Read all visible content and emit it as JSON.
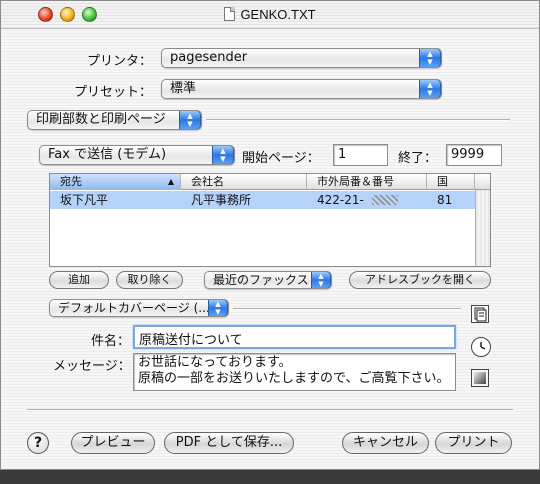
{
  "window": {
    "title": "GENKO.TXT"
  },
  "printer": {
    "label": "プリンタ：",
    "value": "pagesender"
  },
  "preset": {
    "label": "プリセット：",
    "value": "標準"
  },
  "panel_menu": {
    "value": "印刷部数と印刷ページ"
  },
  "fax": {
    "mode_value": "Fax で送信 (モデム)",
    "start_page_label": "開始ページ：",
    "start_page_value": "1",
    "end_label": "終了：",
    "end_value": "9999"
  },
  "recipients": {
    "columns": [
      "宛先",
      "会社名",
      "市外局番＆番号",
      "国"
    ],
    "rows": [
      {
        "name": "坂下凡平",
        "company": "凡平事務所",
        "number": "422-21-",
        "country": "81"
      }
    ]
  },
  "recipient_actions": {
    "add": "追加",
    "remove": "取り除く",
    "recent_fax": "最近のファックス",
    "address_book": "アドレスブックを開く"
  },
  "cover": {
    "page_value": "デフォルトカバーページ (...",
    "subject_label": "件名：",
    "subject_value": "原稿送付について",
    "message_label": "メッセージ：",
    "message_lines": [
      "お世話になっております。",
      "原稿の一部をお送りいたしますので、ご高覧下さい。"
    ]
  },
  "footer": {
    "help": "?",
    "preview": "プレビュー",
    "save_pdf": "PDF として保存...",
    "cancel": "キャンセル",
    "print": "プリント"
  },
  "colors": {
    "selection": "#b5d3fa",
    "accent": "#2c78e0"
  },
  "icons": [
    "document-icon",
    "clock-icon",
    "square-icon"
  ]
}
